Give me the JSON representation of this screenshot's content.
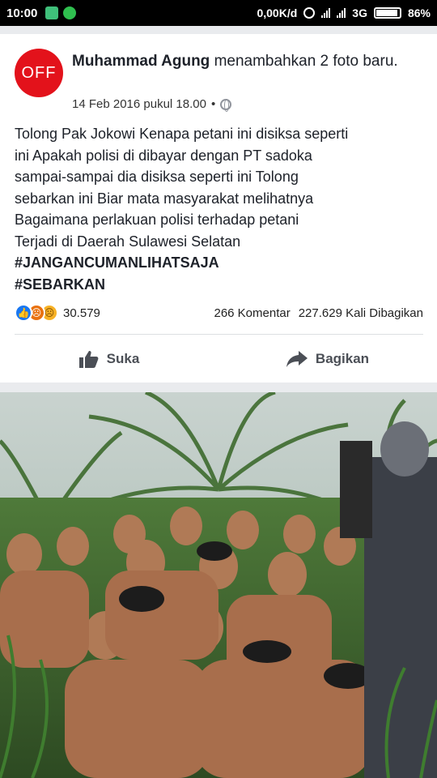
{
  "status_bar": {
    "time": "10:00",
    "speed": "0,00K/d",
    "network": "3G",
    "battery": "86%"
  },
  "post": {
    "avatar_text": "OFF",
    "author": "Muhammad Agung",
    "action_text": "menambahkan 2 foto baru.",
    "timestamp": "14 Feb 2016 pukul 18.00",
    "separator": "•",
    "text_lines": [
      "Tolong Pak Jokowi Kenapa petani ini disiksa seperti",
      "ini Apakah polisi di dibayar dengan PT sadoka",
      "sampai-sampai dia disiksa seperti ini Tolong",
      "sebarkan ini Biar mata masyarakat melihatnya",
      "Bagaimana perlakuan polisi terhadap petani",
      "Terjadi di Daerah Sulawesi Selatan"
    ],
    "hashtags": [
      "#JANGANCUMANLIHATSAJA",
      "#SEBARKAN"
    ],
    "reaction_count": "30.579",
    "comments": "266 Komentar",
    "shares": "227.629 Kali Dibagikan",
    "reactions": [
      "like-icon",
      "angry-icon",
      "sad-icon"
    ]
  },
  "actions": {
    "like_label": "Suka",
    "share_label": "Bagikan"
  },
  "colors": {
    "avatar": "#e3121b",
    "like_blue": "#1877f2",
    "feed_bg": "#e9ebee"
  }
}
